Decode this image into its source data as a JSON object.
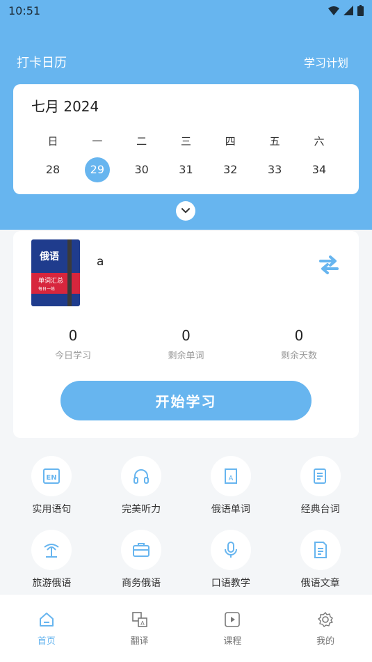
{
  "status": {
    "time": "10:51"
  },
  "header": {
    "left_title": "打卡日历",
    "right_link": "学习计划"
  },
  "calendar": {
    "month_title": "七月 2024",
    "weekdays": [
      "日",
      "一",
      "二",
      "三",
      "四",
      "五",
      "六"
    ],
    "dates": [
      "28",
      "29",
      "30",
      "31",
      "32",
      "33",
      "34"
    ],
    "selected": "29"
  },
  "book": {
    "cover_title": "俄语",
    "cover_band": "单词汇总",
    "cover_sub": "每日一练",
    "name": "a"
  },
  "stats": [
    {
      "value": "0",
      "label": "今日学习"
    },
    {
      "value": "0",
      "label": "剩余单词"
    },
    {
      "value": "0",
      "label": "剩余天数"
    }
  ],
  "start_button": "开始学习",
  "features": [
    {
      "label": "实用语句",
      "icon": "en-card-icon"
    },
    {
      "label": "完美听力",
      "icon": "headphones-icon"
    },
    {
      "label": "俄语单词",
      "icon": "word-book-icon"
    },
    {
      "label": "经典台词",
      "icon": "script-icon"
    },
    {
      "label": "旅游俄语",
      "icon": "palm-tree-icon"
    },
    {
      "label": "商务俄语",
      "icon": "briefcase-icon"
    },
    {
      "label": "口语教学",
      "icon": "microphone-icon"
    },
    {
      "label": "俄语文章",
      "icon": "article-icon"
    }
  ],
  "tabs": [
    {
      "label": "首页",
      "icon": "home-icon",
      "active": true
    },
    {
      "label": "翻译",
      "icon": "translate-icon",
      "active": false
    },
    {
      "label": "课程",
      "icon": "course-play-icon",
      "active": false
    },
    {
      "label": "我的",
      "icon": "gear-icon",
      "active": false
    }
  ],
  "colors": {
    "accent": "#67b5ef",
    "page_bg": "#f4f6f8"
  }
}
